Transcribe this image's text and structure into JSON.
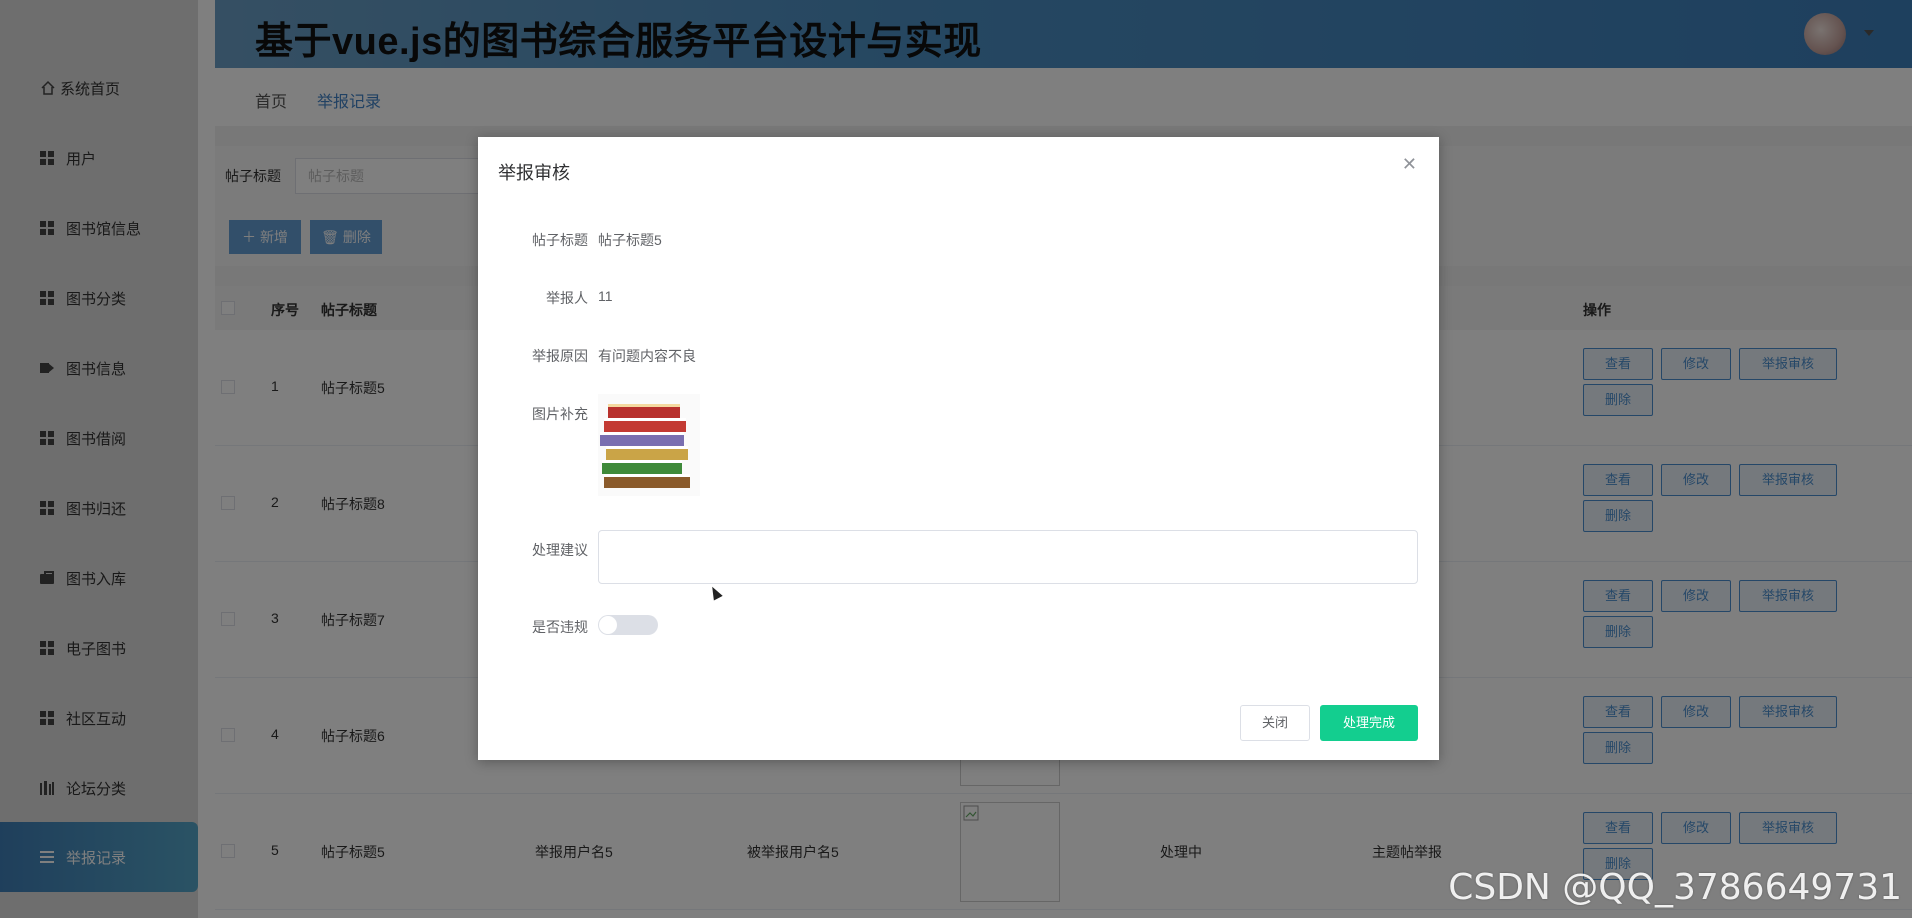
{
  "header": {
    "title": "基于vue.js的图书综合服务平台设计与实现"
  },
  "sidebar": {
    "items": [
      {
        "label": "系统首页",
        "icon": "home-icon"
      },
      {
        "label": "用户",
        "icon": "grid-icon"
      },
      {
        "label": "图书馆信息",
        "icon": "grid-icon"
      },
      {
        "label": "图书分类",
        "icon": "grid-icon"
      },
      {
        "label": "图书信息",
        "icon": "video-icon"
      },
      {
        "label": "图书借阅",
        "icon": "grid-icon"
      },
      {
        "label": "图书归还",
        "icon": "grid-icon"
      },
      {
        "label": "图书入库",
        "icon": "bag-icon"
      },
      {
        "label": "电子图书",
        "icon": "grid-icon"
      },
      {
        "label": "社区互动",
        "icon": "grid-icon"
      },
      {
        "label": "论坛分类",
        "icon": "bars-icon"
      },
      {
        "label": "举报记录",
        "icon": "list-icon"
      }
    ]
  },
  "breadcrumb": {
    "home": "首页",
    "current": "举报记录"
  },
  "search": {
    "label": "帖子标题",
    "placeholder": "帖子标题"
  },
  "toolbar": {
    "add_label": "新增",
    "delete_label": "删除"
  },
  "table": {
    "headers": [
      "序号",
      "帖子标题",
      "操作"
    ],
    "rows": [
      {
        "index": "1",
        "title": "帖子标题5"
      },
      {
        "index": "2",
        "title": "帖子标题8"
      },
      {
        "index": "3",
        "title": "帖子标题7"
      },
      {
        "index": "4",
        "title": "帖子标题6"
      },
      {
        "index": "5",
        "title": "帖子标题5",
        "reporter": "举报用户名5",
        "reported": "被举报用户名5",
        "status": "处理中",
        "type": "主题帖举报"
      }
    ],
    "actions": {
      "view": "查看",
      "edit": "修改",
      "review": "举报审核",
      "delete": "删除"
    }
  },
  "dialog": {
    "title": "举报审核",
    "fields": {
      "post_title_label": "帖子标题",
      "post_title_value": "帖子标题5",
      "reporter_label": "举报人",
      "reporter_value": "11",
      "reason_label": "举报原因",
      "reason_value": "有问题内容不良",
      "image_label": "图片补充",
      "suggestion_label": "处理建议",
      "suggestion_value": "",
      "violation_label": "是否违规"
    },
    "violation_on": false,
    "close_label": "关闭",
    "done_label": "处理完成"
  },
  "watermark": "CSDN @QQ_3786649731",
  "colors": {
    "accent": "#4b8fd0",
    "success": "#13ce8f",
    "active_menu": "#4a90c2"
  }
}
